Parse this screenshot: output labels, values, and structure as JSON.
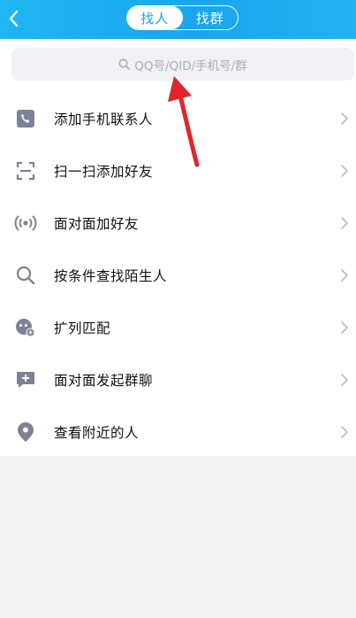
{
  "header": {
    "tabs": [
      {
        "label": "找人",
        "active": true
      },
      {
        "label": "找群",
        "active": false
      }
    ],
    "accent_color": "#1aa6ee"
  },
  "search": {
    "placeholder": "QQ号/QID/手机号/群",
    "icon": "search-icon"
  },
  "menu": {
    "items": [
      {
        "label": "添加手机联系人",
        "icon": "phone-icon"
      },
      {
        "label": "扫一扫添加好友",
        "icon": "scan-icon"
      },
      {
        "label": "面对面加好友",
        "icon": "signal-icon"
      },
      {
        "label": "按条件查找陌生人",
        "icon": "search-icon"
      },
      {
        "label": "扩列匹配",
        "icon": "match-icon"
      },
      {
        "label": "面对面发起群聊",
        "icon": "group-chat-icon"
      },
      {
        "label": "查看附近的人",
        "icon": "location-icon"
      }
    ]
  },
  "annotation": {
    "arrow_color": "#e0262a"
  }
}
